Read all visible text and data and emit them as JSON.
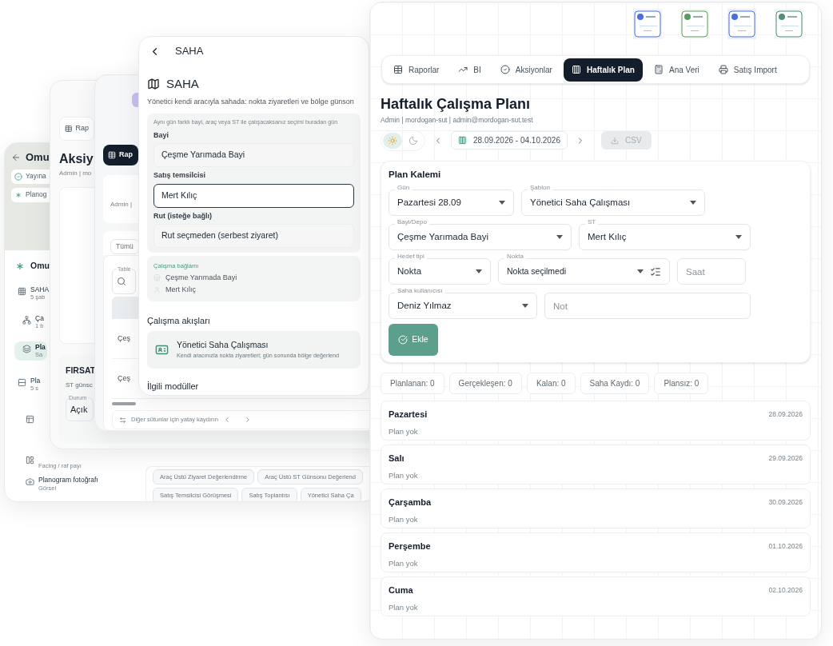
{
  "planogram_screen": {
    "title": "Omu",
    "chips": [
      "Yayına",
      "Planog"
    ],
    "card_title": "Omu",
    "nav": [
      {
        "title": "SAHA",
        "subtitle": "5 şab",
        "selected": false,
        "children": [
          {
            "title": "Ça",
            "subtitle": "1 b",
            "selected": false
          },
          {
            "title": "Pla",
            "subtitle": "Sa",
            "selected": true
          }
        ]
      },
      {
        "title": "Pla",
        "subtitle": "5 s",
        "selected": false,
        "children": [
          {
            "selected": false
          },
          {
            "subtitle": "Facing / raf payı",
            "selected": false
          },
          {
            "title": "Planogram fotoğrafı",
            "subtitle": "Görsel",
            "selected": false
          }
        ]
      }
    ],
    "templates": [
      "Araç Üstü Ziyaret Değerlendirme",
      "Araç Üstü ST Günsonu Değerlend",
      "Satış Temsilcisi Görüşmesi",
      "Satış Toplantısı",
      "Yönetici Saha Ça"
    ]
  },
  "actions_screen": {
    "tab": "Rap",
    "title": "Aksiy",
    "subtitle": "Admin | mo",
    "section_title": "FIRSAT",
    "section_subtitle": "ST günsc",
    "field": {
      "label": "Durum",
      "value": "Açık"
    }
  },
  "reports_screen": {
    "tab": {
      "label": "Rap",
      "selected": true
    },
    "subtitle": "Admin | ",
    "filter_chip": "Tümü",
    "search": {
      "label": "Table"
    },
    "rows": [
      "Çeş",
      "Çeş"
    ],
    "scroll_hint": "Diğer sütunlar için yatay kaydırın"
  },
  "field_screen": {
    "header_title": "SAHA",
    "title": "SAHA",
    "description": "Yönetici kendi aracıyla sahada: nokta ziyaretleri ve bölge günson",
    "hint": "Aynı gün farklı bayi, araç veya ST ile çalışacaksanız seçimi buradan gün",
    "fields": [
      {
        "label": "Bayi",
        "value": "Çeşme Yarımada Bayi",
        "focused": false
      },
      {
        "label": "Satış temsilcisi",
        "value": "Mert Kılıç",
        "focused": true
      },
      {
        "label": "Rut (isteğe bağlı)",
        "value": "Rut seçmeden (serbest ziyaret)",
        "focused": false
      }
    ],
    "context": {
      "title": "Çalışma bağlamı",
      "items": [
        {
          "kind": "dealer",
          "text": "Çeşme Yarımada Bayi"
        },
        {
          "kind": "person",
          "text": "Mert Kılıç"
        }
      ]
    },
    "flows_title": "Çalışma akışları",
    "flow": {
      "title": "Yönetici Saha Çalışması",
      "description": "Kendi aracınızla nokta ziyaretleri; gün sonunda bölge değerlend"
    },
    "modules_title": "İlgili modüller"
  },
  "weekly_plan_screen": {
    "tabs": [
      {
        "label": "Raporlar",
        "selected": false
      },
      {
        "label": "BI",
        "selected": false
      },
      {
        "label": "Aksiyonlar",
        "selected": false
      },
      {
        "label": "Haftalık Plan",
        "selected": true
      },
      {
        "label": "Ana Veri",
        "selected": false
      },
      {
        "label": "Satış Import",
        "selected": false
      }
    ],
    "title": "Haftalık Çalışma Planı",
    "subtitle": "Admin | mordogan-sut | admin@mordogan-sut.test",
    "theme_toggle": [
      {
        "kind": "light",
        "selected": true
      },
      {
        "kind": "dark",
        "selected": false
      }
    ],
    "date_range": "28.09.2026 - 04.10.2026",
    "csv_button": {
      "label": "CSV",
      "disabled": true
    },
    "form": {
      "title": "Plan Kalemi",
      "rows": [
        [
          {
            "kind": "select",
            "label": "Gün",
            "value": "Pazartesi 28.09"
          },
          {
            "kind": "select",
            "label": "Şablon",
            "value": "Yönetici Saha Çalışması"
          }
        ],
        [
          {
            "kind": "select",
            "label": "Bayi/Depo",
            "value": "Çeşme Yarımada Bayi"
          },
          {
            "kind": "select",
            "label": "ST",
            "value": "Mert Kılıç"
          }
        ],
        [
          {
            "kind": "select",
            "label": "Hedef tipi",
            "value": "Nokta"
          },
          {
            "kind": "picker",
            "label": "Nokta",
            "value": "Nokta seçilmedi"
          },
          {
            "kind": "input",
            "placeholder": "Saat"
          }
        ],
        [
          {
            "kind": "select",
            "label": "Saha kullanıcısı",
            "value": "Deniz Yılmaz"
          },
          {
            "kind": "input",
            "placeholder": "Not"
          }
        ]
      ],
      "add_button": "Ekle"
    },
    "stats": [
      "Planlanan: 0",
      "Gerçekleşen: 0",
      "Kalan: 0",
      "Saha Kaydı: 0",
      "Plansız: 0"
    ],
    "days": [
      {
        "name": "Pazartesi",
        "date": "28.09.2026",
        "status": "Plan yok"
      },
      {
        "name": "Salı",
        "date": "29.09.2026",
        "status": "Plan yok"
      },
      {
        "name": "Çarşamba",
        "date": "30.09.2026",
        "status": "Plan yok"
      },
      {
        "name": "Perşembe",
        "date": "01.10.2026",
        "status": "Plan yok"
      },
      {
        "name": "Cuma",
        "date": "02.10.2026",
        "status": "Plan yok"
      }
    ]
  }
}
